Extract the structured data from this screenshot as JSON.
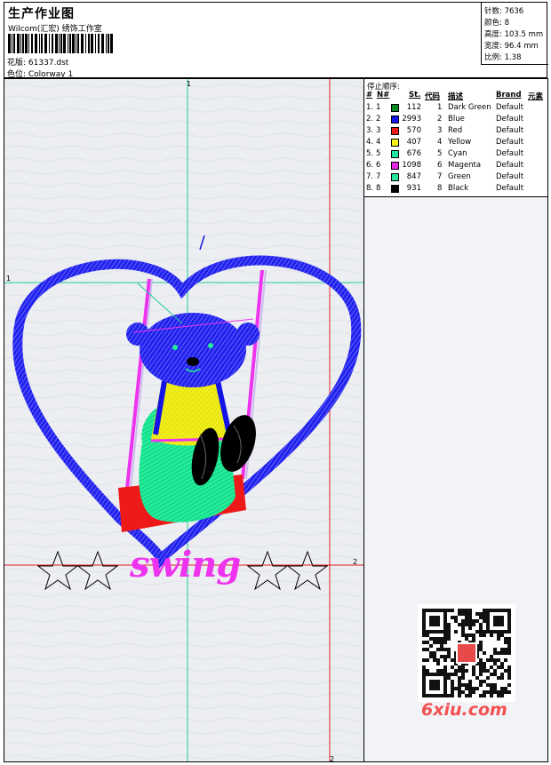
{
  "header": {
    "title": "生产作业图",
    "subtitle": "Wilcom(汇宏) 绣饰工作室",
    "file_label": "花版: 61337.dst",
    "colorway_label": "色位: Colorway 1"
  },
  "stats": [
    {
      "label": "针数: 7636"
    },
    {
      "label": "颜色: 8"
    },
    {
      "label": "高度: 103.5 mm"
    },
    {
      "label": "宽度: 96.4 mm"
    },
    {
      "label": "比例: 1.38"
    }
  ],
  "sequence": {
    "title": "停止顺序:",
    "headers": {
      "num": "#",
      "no": "N#",
      "st": "St.",
      "code": "代码",
      "desc": "描述",
      "brand": "Brand",
      "elem": "元素"
    },
    "rows": [
      {
        "num": "1.",
        "no": "1",
        "st": "112",
        "code": "1",
        "desc": "Dark Green",
        "brand": "Default",
        "color": "#0a8a1e"
      },
      {
        "num": "2.",
        "no": "2",
        "st": "2993",
        "code": "2",
        "desc": "Blue",
        "brand": "Default",
        "color": "#1414e6"
      },
      {
        "num": "3.",
        "no": "3",
        "st": "570",
        "code": "3",
        "desc": "Red",
        "brand": "Default",
        "color": "#ee1a1a"
      },
      {
        "num": "4.",
        "no": "4",
        "st": "407",
        "code": "4",
        "desc": "Yellow",
        "brand": "Default",
        "color": "#f4f21a"
      },
      {
        "num": "5.",
        "no": "5",
        "st": "676",
        "code": "5",
        "desc": "Cyan",
        "brand": "Default",
        "color": "#1ee6a0"
      },
      {
        "num": "6.",
        "no": "6",
        "st": "1098",
        "code": "6",
        "desc": "Magenta",
        "brand": "Default",
        "color": "#e628e6"
      },
      {
        "num": "7.",
        "no": "7",
        "st": "847",
        "code": "7",
        "desc": "Green",
        "brand": "Default",
        "color": "#28e69a"
      },
      {
        "num": "8.",
        "no": "8",
        "st": "931",
        "code": "8",
        "desc": "Black",
        "brand": "Default",
        "color": "#000000"
      }
    ]
  },
  "design": {
    "text": "swing",
    "guide_labels": [
      "1",
      "1",
      "2",
      "2"
    ]
  },
  "watermark": {
    "logo": "6xiu.com"
  }
}
